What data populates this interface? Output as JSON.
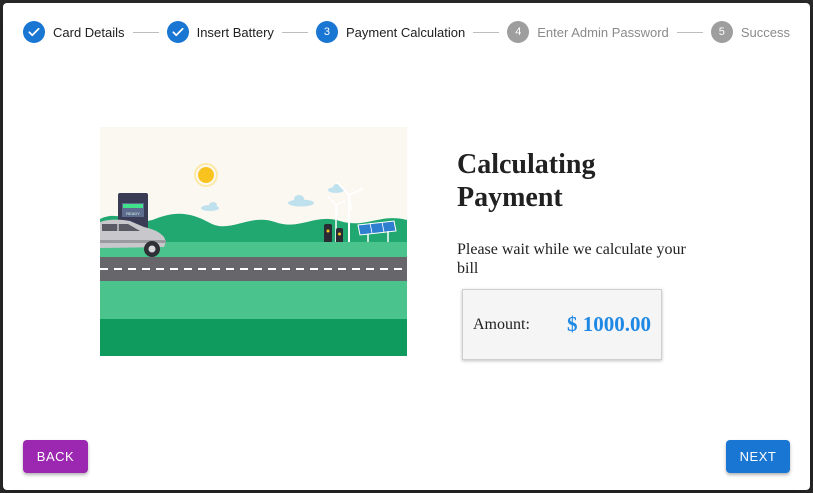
{
  "stepper": {
    "steps": [
      {
        "label": "Card Details",
        "state": "completed",
        "marker": ""
      },
      {
        "label": "Insert Battery",
        "state": "completed",
        "marker": ""
      },
      {
        "label": "Payment Calculation",
        "state": "active",
        "marker": "3"
      },
      {
        "label": "Enter Admin Password",
        "state": "pending",
        "marker": "4"
      },
      {
        "label": "Success",
        "state": "pending",
        "marker": "5"
      }
    ]
  },
  "illustration": {
    "charger_screen_text": "READY",
    "colors": {
      "sky": "#fbf8f2",
      "sun": "#f9c31f",
      "hills": "#20a870",
      "road": "#67666a",
      "grass_light": "#4bc38d",
      "grass_dark": "#0f9a5e"
    }
  },
  "content": {
    "title": "Calculating Payment",
    "description": "Please wait while we calculate your bill",
    "amount_label": "Amount:",
    "amount_value": "$ 1000.00"
  },
  "actions": {
    "back_label": "BACK",
    "next_label": "NEXT"
  },
  "colors": {
    "primary": "#1976d2",
    "secondary": "#9c27b0",
    "pending": "#9e9e9e",
    "amount": "#1e88e5"
  }
}
